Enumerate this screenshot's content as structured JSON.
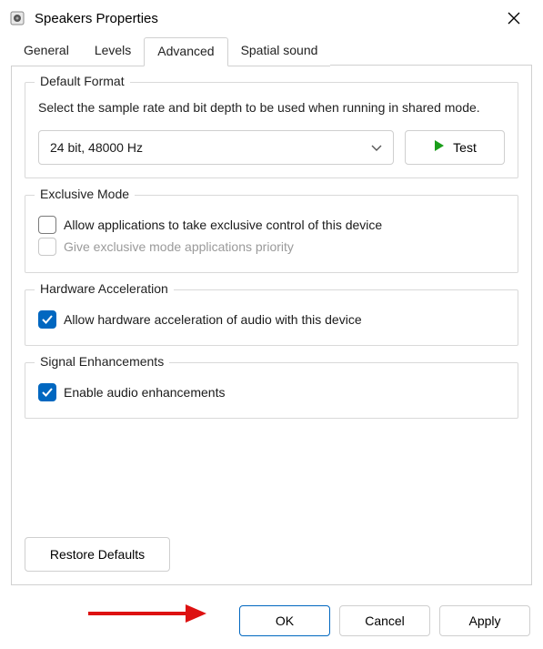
{
  "window": {
    "title": "Speakers Properties"
  },
  "tabs": {
    "general": "General",
    "levels": "Levels",
    "advanced": "Advanced",
    "spatial": "Spatial sound"
  },
  "defaultFormat": {
    "legend": "Default Format",
    "description": "Select the sample rate and bit depth to be used when running in shared mode.",
    "selected": "24 bit, 48000 Hz",
    "testLabel": "Test"
  },
  "exclusiveMode": {
    "legend": "Exclusive Mode",
    "allowExclusive": "Allow applications to take exclusive control of this device",
    "givePriority": "Give exclusive mode applications priority"
  },
  "hardwareAccel": {
    "legend": "Hardware Acceleration",
    "allowHw": "Allow hardware acceleration of audio with this device"
  },
  "signalEnh": {
    "legend": "Signal Enhancements",
    "enable": "Enable audio enhancements"
  },
  "restore": "Restore Defaults",
  "buttons": {
    "ok": "OK",
    "cancel": "Cancel",
    "apply": "Apply"
  }
}
